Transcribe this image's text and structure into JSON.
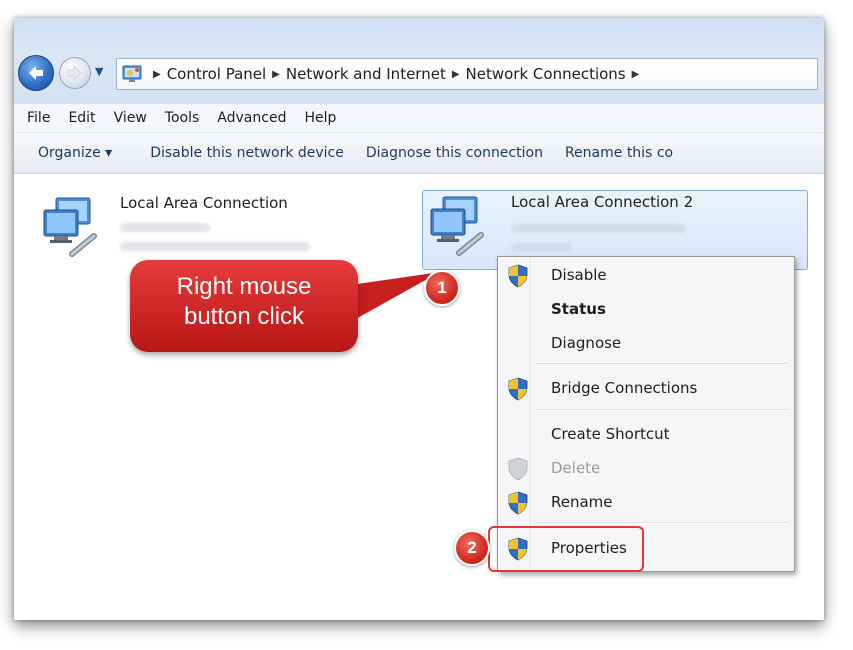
{
  "breadcrumb": [
    "Control Panel",
    "Network and Internet",
    "Network Connections"
  ],
  "menu": [
    "File",
    "Edit",
    "View",
    "Tools",
    "Advanced",
    "Help"
  ],
  "commands": {
    "organize": "Organize ▾",
    "disable_device": "Disable this network device",
    "diagnose": "Diagnose this connection",
    "rename": "Rename this co"
  },
  "connections": [
    {
      "name": "Local Area Connection"
    },
    {
      "name": "Local Area Connection 2"
    }
  ],
  "callout": {
    "line1": "Right mouse",
    "line2": "button click"
  },
  "badges": {
    "step1": "1",
    "step2": "2"
  },
  "context_menu": {
    "disable": "Disable",
    "status": "Status",
    "diagnose": "Diagnose",
    "bridge": "Bridge Connections",
    "create_shortcut": "Create Shortcut",
    "delete": "Delete",
    "rename": "Rename",
    "properties": "Properties"
  },
  "colors": {
    "accent_red": "#d22b20",
    "selection_blue": "#84acdd",
    "chrome_blue": "#cfe0f2"
  },
  "icons": {
    "back": "back-arrow-icon",
    "forward": "forward-arrow-icon",
    "address": "control-panel-icon",
    "connection": "network-connection-icon",
    "shield": "uac-shield-icon"
  }
}
